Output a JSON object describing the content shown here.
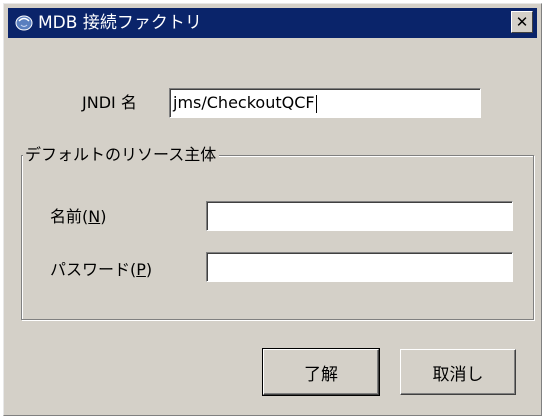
{
  "window": {
    "title": "MDB 接続ファクトリ",
    "close_glyph": "✕"
  },
  "jndi": {
    "label": "JNDI 名",
    "value": "jms/CheckoutQCF"
  },
  "resource_group": {
    "title": "デフォルトのリソース主体",
    "name_label_prefix": "名前(",
    "name_mnemonic": "N",
    "name_label_suffix": ")",
    "name_value": "",
    "password_label_prefix": "パスワード(",
    "password_mnemonic": "P",
    "password_label_suffix": ")",
    "password_value": ""
  },
  "buttons": {
    "ok_label": "了解",
    "cancel_label": "取消し"
  },
  "icons": {
    "app": "coffee-cup-icon",
    "close": "close-icon"
  },
  "colors": {
    "titlebar": "#0a246a",
    "dialog_bg": "#d4d0c8"
  }
}
